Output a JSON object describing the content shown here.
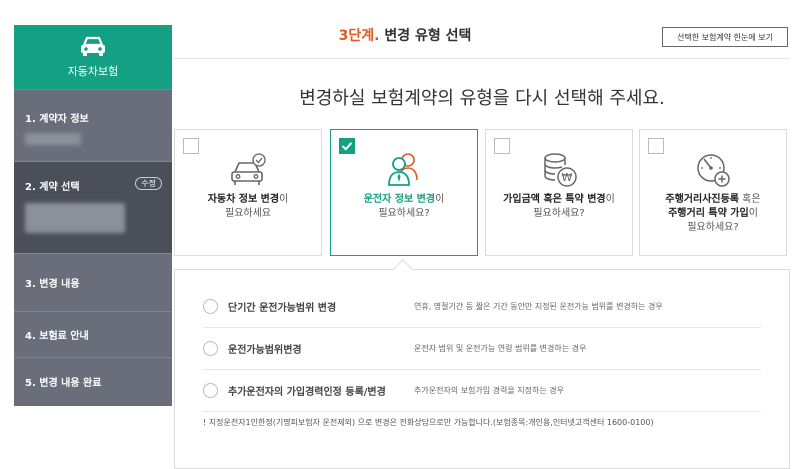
{
  "sidebar": {
    "header_label": "자동차보험",
    "items": [
      {
        "label": "1. 계약자 정보"
      },
      {
        "label": "2. 계약 선택",
        "badge": "수정"
      },
      {
        "label": "3. 변경 내용"
      },
      {
        "label": "4. 보험료 안내"
      },
      {
        "label": "5. 변경 내용 완료"
      }
    ]
  },
  "header": {
    "step": "3단계.",
    "title": "변경 유형 선택",
    "summary_button": "선택한 보험계약 한눈에 보기"
  },
  "question": "변경하실 보험계약의 유형을 다시 선택해 주세요.",
  "options": [
    {
      "bold": "자동차 정보 변경",
      "rest": "이",
      "line2": "필요하세요",
      "icon": "car-check-icon",
      "selected": false
    },
    {
      "bold": "운전자 정보 변경",
      "rest": "이",
      "line2": "필요하세요?",
      "icon": "driver-people-icon",
      "selected": true
    },
    {
      "bold": "가입금액 혹은 특약 변경",
      "rest": "이",
      "line2": "필요하세요?",
      "icon": "coin-stack-icon",
      "selected": false
    },
    {
      "bold": "주행거리사진등록",
      "rest": " 혹은",
      "bold2": "주행거리 특약 가입",
      "rest2": "이",
      "line3": "필요하세요?",
      "icon": "odometer-add-icon",
      "selected": false
    }
  ],
  "sub_options": [
    {
      "label": "단기간 운전가능범위 변경",
      "desc": "연휴, 명절기간 등 짧은 기간 동안만 지정된 운전가능 범위를 변경하는 경우"
    },
    {
      "label": "운전가능범위변경",
      "desc": "운전자 범위 및 운전가능 연령 범위를 변경하는 경우"
    },
    {
      "label": "추가운전자의 가입경력인정 등록/변경",
      "desc": "추가운전자의 보험가입 경력을 지정하는 경우"
    }
  ],
  "note": "! 지정운전자1인한정(기명피보험자 운전제외) 으로 변경은 전화상담으로만 가능합니다.(보험종목:개인용,인터넷고객센터 1600-0100)",
  "colors": {
    "accent": "#14a085",
    "step": "#e05a1f",
    "sidebar": "#6a6e7a",
    "sidebar_active": "#4b4f5a"
  }
}
